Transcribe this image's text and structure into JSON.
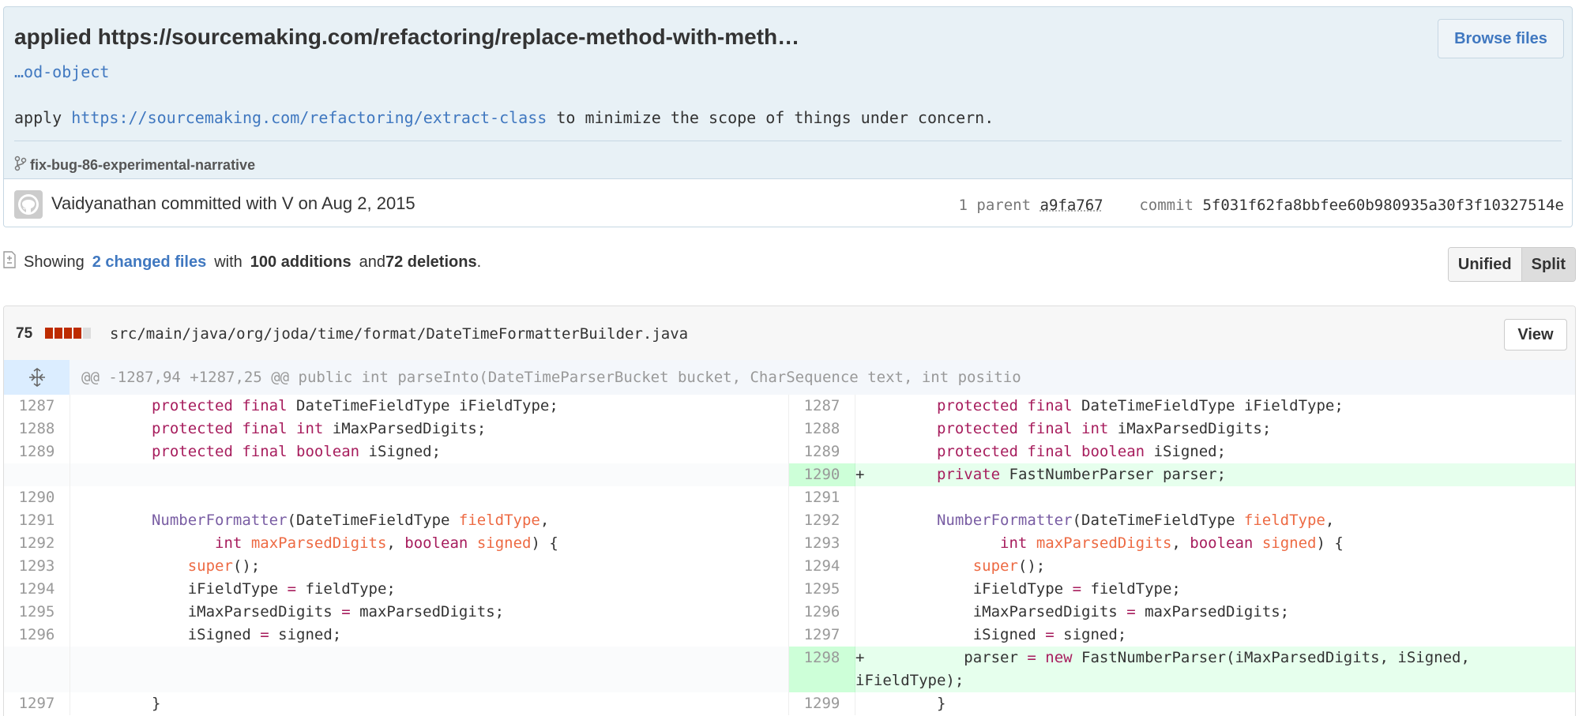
{
  "commit": {
    "title_prefix": "applied",
    "title_link": "https://sourcemaking.com/refactoring/replace-method-with-meth…",
    "title_continuation": "…od-object",
    "desc_prefix": "apply ",
    "desc_url": "https://sourcemaking.com/refactoring/extract-class",
    "desc_suffix": " to minimize the scope of things under concern.",
    "branch": "fix-bug-86-experimental-narrative",
    "browse_label": "Browse files",
    "author_line": "Vaidyanathan committed with V on Aug 2, 2015",
    "parent_label": "1 parent",
    "parent_sha": "a9fa767",
    "commit_label": "commit",
    "commit_sha": "5f031f62fa8bbfee60b980935a30f3f10327514e"
  },
  "summary": {
    "showing": "Showing",
    "changed_files": "2 changed files",
    "with": "with",
    "additions": "100 additions",
    "and": "and",
    "deletions": "72 deletions",
    "period": "."
  },
  "view_toggle": {
    "unified": "Unified",
    "split": "Split",
    "active": "Split"
  },
  "file": {
    "change_count": "75",
    "path": "src/main/java/org/joda/time/format/DateTimeFormatterBuilder.java",
    "view_label": "View",
    "hunk": "@@ -1287,94 +1287,25 @@ public int parseInto(DateTimeParserBucket bucket, CharSequence text, int positio"
  },
  "diff_rows": [
    {
      "l": "1287",
      "r": "1287"
    },
    {
      "l": "1288",
      "r": "1288"
    },
    {
      "l": "1289",
      "r": "1289"
    },
    {
      "l": "",
      "r": "1290",
      "r_sign": "+"
    },
    {
      "l": "1290",
      "r": "1291"
    },
    {
      "l": "1291",
      "r": "1292"
    },
    {
      "l": "1292",
      "r": "1293"
    },
    {
      "l": "1293",
      "r": "1294"
    },
    {
      "l": "1294",
      "r": "1295"
    },
    {
      "l": "1295",
      "r": "1296"
    },
    {
      "l": "1296",
      "r": "1297"
    },
    {
      "l": "",
      "r": "1298",
      "r_sign": "+"
    },
    {
      "l": "1297",
      "r": "1299"
    }
  ],
  "code": {
    "protected": "protected",
    "final": "final",
    "int": "int",
    "boolean": "boolean",
    "private": "private",
    "super": "super",
    "new": "new",
    "eq": "=",
    "DateTimeFieldType": "DateTimeFieldType",
    "iFieldType": "iFieldType;",
    "iMaxParsedDigits": "iMaxParsedDigits;",
    "iSigned": "iSigned;",
    "FastNumberParser": "FastNumberParser parser;",
    "NumberFormatter": "NumberFormatter",
    "fieldType": "fieldType",
    "maxParsedDigits": "maxParsedDigits",
    "signed": "signed",
    "super_call": "();",
    "iFieldType_assign_l": "iFieldType ",
    "iFieldType_assign_r": " fieldType;",
    "iMax_assign_l": "iMaxParsedDigits ",
    "iMax_assign_r": " maxParsedDigits;",
    "iSigned_assign_l": "iSigned ",
    "iSigned_assign_r": " signed;",
    "parser_assign_l": "parser ",
    "parser_assign_r": " FastNumberParser(iMaxParsedDigits, iSigned,",
    "parser_assign_wrap": "iFieldType);",
    "close_brace": "}"
  }
}
